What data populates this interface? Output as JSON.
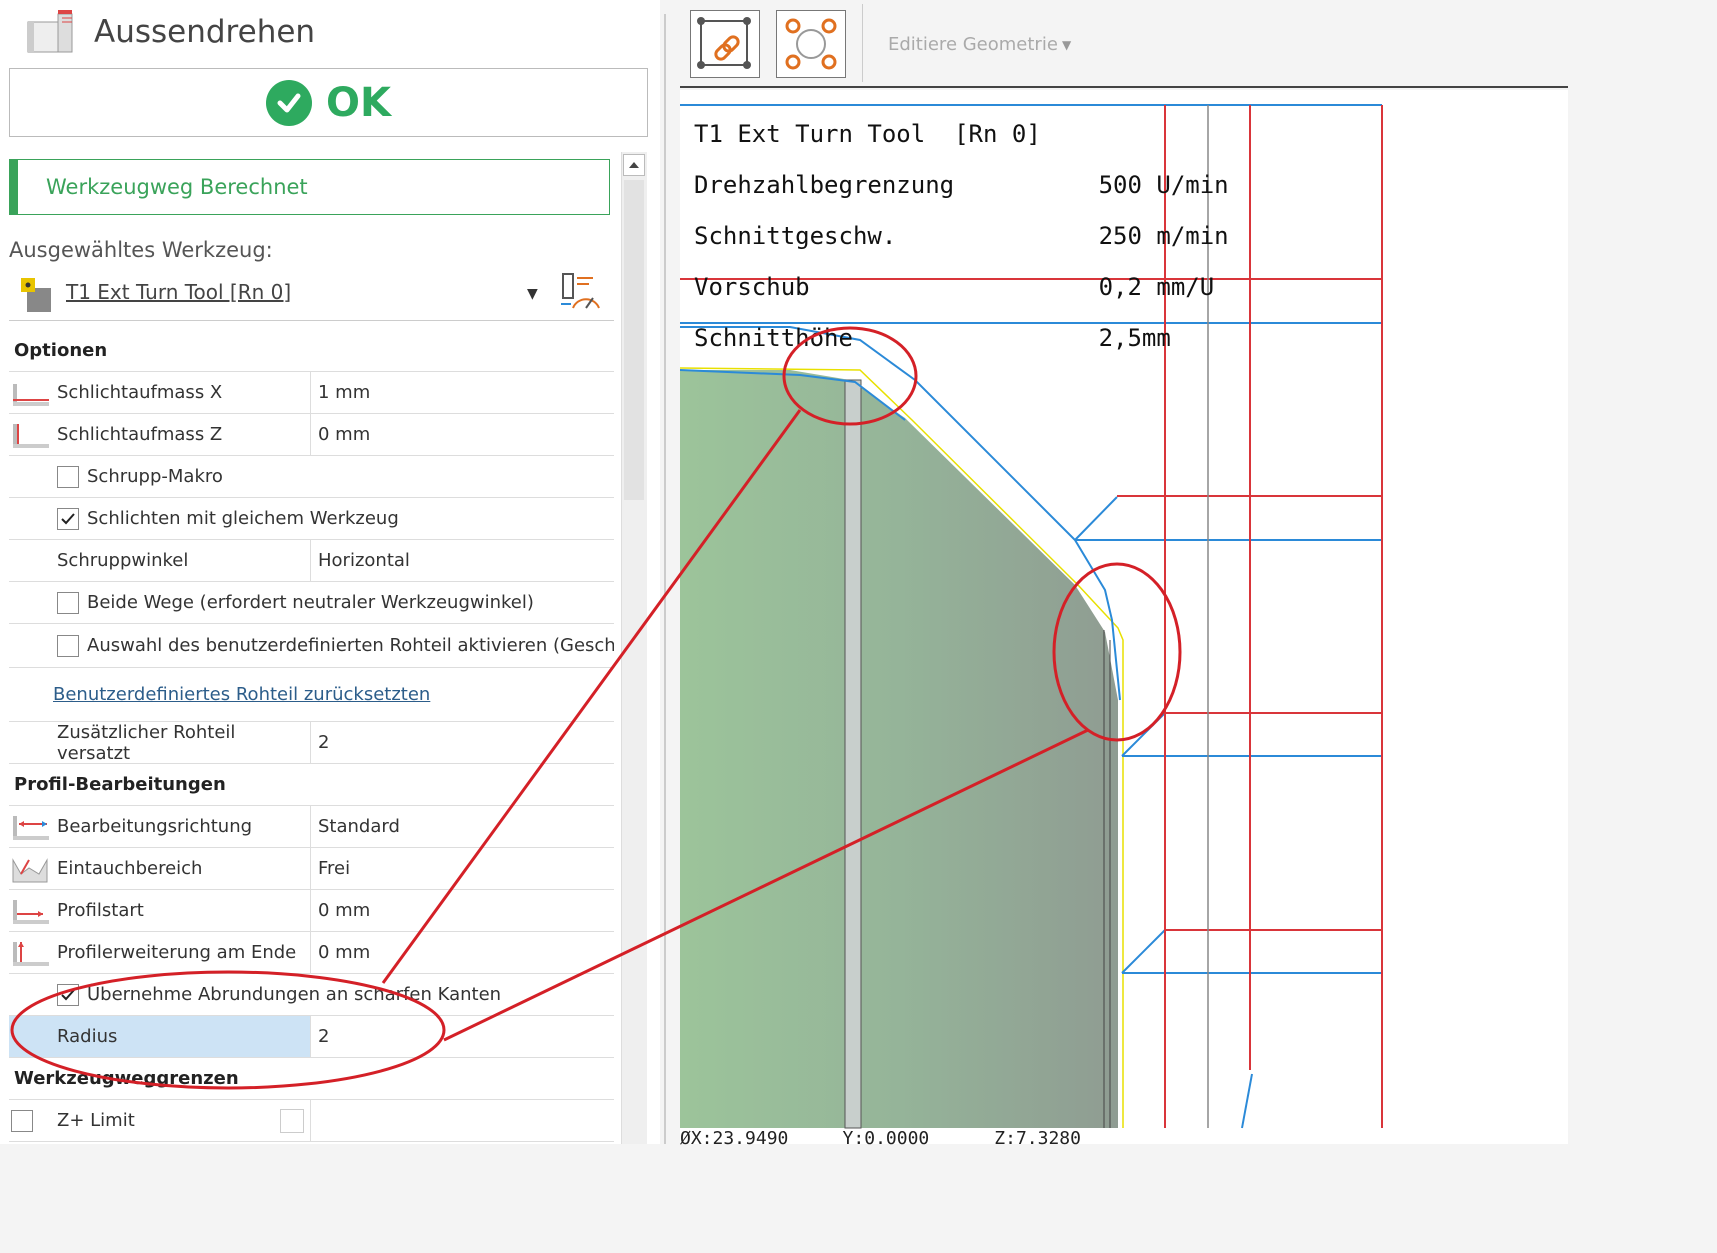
{
  "panel": {
    "title": "Aussendrehen",
    "ok_label": "OK",
    "status": "Werkzeugweg Berechnet",
    "selected_tool_label": "Ausgewähltes Werkzeug:",
    "tool_name": "T1 Ext Turn Tool  [Rn 0]"
  },
  "options": {
    "header": "Optionen",
    "schlichtaufmass_x": {
      "label": "Schlichtaufmass X",
      "value": "1 mm"
    },
    "schlichtaufmass_z": {
      "label": "Schlichtaufmass Z",
      "value": "0 mm"
    },
    "schrupp_makro": {
      "label": "Schrupp-Makro",
      "checked": false
    },
    "schlichten": {
      "label": "Schlichten mit gleichem Werkzeug",
      "checked": true
    },
    "schruppwinkel": {
      "label": "Schruppwinkel",
      "value": "Horizontal"
    },
    "beide_wege": {
      "label": "Beide Wege (erfordert neutraler Werkzeugwinkel)",
      "checked": false
    },
    "auswahl_rohteil": {
      "label": "Auswahl des benutzerdefinierten Rohteil aktivieren (Geschlossen)",
      "checked": false
    },
    "reset_link": "Benutzerdefiniertes Rohteil zurücksetzten",
    "rohteil_versatz": {
      "label": "Zusätzlicher Rohteil versatzt",
      "value": "2"
    }
  },
  "profil": {
    "header": "Profil-Bearbeitungen",
    "richtung": {
      "label": "Bearbeitungsrichtung",
      "value": "Standard"
    },
    "eintauch": {
      "label": "Eintauchbereich",
      "value": "Frei"
    },
    "start": {
      "label": "Profilstart",
      "value": "0 mm"
    },
    "erweiterung": {
      "label": "Profilerweiterung am Ende",
      "value": "0 mm"
    },
    "abrundungen": {
      "label": "Übernehme Abrundungen an scharfen Kanten",
      "checked": true
    },
    "radius": {
      "label": "Radius",
      "value": "2"
    }
  },
  "grenzen": {
    "header": "Werkzeugweggrenzen",
    "zplus": {
      "label": "Z+ Limit"
    }
  },
  "toolbar": {
    "edit_geometry": "Editiere Geometrie"
  },
  "viewport": {
    "readout_lines": [
      "T1 Ext Turn Tool  [Rn 0]",
      "Drehzahlbegrenzung          500 U/min",
      "Schnittgeschw.              250 m/min",
      "Vorschub                    0,2 mm/U",
      "Schnitthöhe                 2,5mm"
    ],
    "coords": "ØX:23.9490     Y:0.0000      Z:7.3280"
  },
  "colors": {
    "accent_green": "#2eaa5f",
    "stock_green": "#9cc49a",
    "toolpath_blue": "#2b8ad8",
    "boundary_red": "#d9353a",
    "annotation_red": "#d42027",
    "selection_blue": "#cde3f5"
  }
}
